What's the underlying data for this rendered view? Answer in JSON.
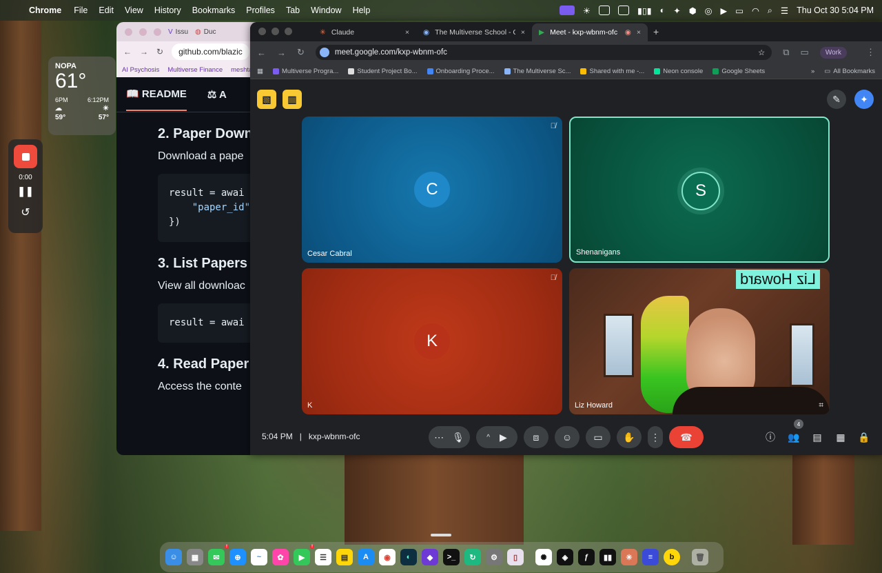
{
  "menubar": {
    "app": "Chrome",
    "items": [
      "File",
      "Edit",
      "View",
      "History",
      "Bookmarks",
      "Profiles",
      "Tab",
      "Window",
      "Help"
    ],
    "datetime": "Thu Oct 30  5:04 PM"
  },
  "weather": {
    "location": "NOPA",
    "temp": "61°",
    "hours": [
      {
        "time": "6PM",
        "temp": "59°"
      },
      {
        "time": "6:12PM",
        "temp": "57°"
      }
    ]
  },
  "recorder": {
    "elapsed": "0:00"
  },
  "github": {
    "tabs": [
      "Issu",
      "Duc"
    ],
    "url": "github.com/blazic",
    "bookmarks": [
      "AI Psychosis",
      "Multiverse Finance",
      "meshta"
    ],
    "readme_tab": "README",
    "second_tab": "A",
    "sections": [
      {
        "heading": "2. Paper Down",
        "text": "Download a pape",
        "code": [
          "result = awai",
          "    \"paper_id\"",
          "})"
        ]
      },
      {
        "heading": "3. List Papers",
        "text": "View all downloac",
        "code": [
          "result = awai"
        ]
      },
      {
        "heading": "4. Read Paper",
        "text": "Access the conte"
      }
    ]
  },
  "meet_window": {
    "tabs": [
      {
        "title": "Claude",
        "active": false
      },
      {
        "title": "The Multiverse School - Cale",
        "active": false
      },
      {
        "title": "Meet - kxp-wbnm-ofc",
        "active": true
      }
    ],
    "url": "meet.google.com/kxp-wbnm-ofc",
    "profile": "Work",
    "bookmarks": [
      "Multiverse Progra...",
      "Student Project Bo...",
      "Onboarding Proce...",
      "The Multiverse Sc...",
      "Shared with me -...",
      "Neon console",
      "Google Sheets"
    ],
    "all_bookmarks": "All Bookmarks"
  },
  "meet": {
    "participants": [
      {
        "name": "Cesar Cabral",
        "initial": "C",
        "muted": true,
        "color": "#1e88c9"
      },
      {
        "name": "Shenanigans",
        "initial": "S",
        "muted": false,
        "color": "#0a6e52"
      },
      {
        "name": "K",
        "initial": "K",
        "muted": true,
        "color": "#b8321a"
      },
      {
        "name": "Liz Howard",
        "initial": "",
        "muted": false,
        "video": true
      }
    ],
    "overlay_name": "Liz Howard",
    "time": "5:04 PM",
    "code": "kxp-wbnm-ofc",
    "people_count": "4"
  },
  "dock": {
    "apps": [
      "finder",
      "launchpad",
      "messages",
      "safari",
      "freeform",
      "photos",
      "facetime",
      "reminders",
      "notes",
      "app-store",
      "chrome",
      "cursor",
      "obsidian",
      "terminal",
      "chatgpt-like",
      "settings",
      "screen-tool",
      "openai",
      "notion-like",
      "script",
      "sound",
      "claude",
      "lines",
      "bcircle",
      "trash"
    ]
  }
}
